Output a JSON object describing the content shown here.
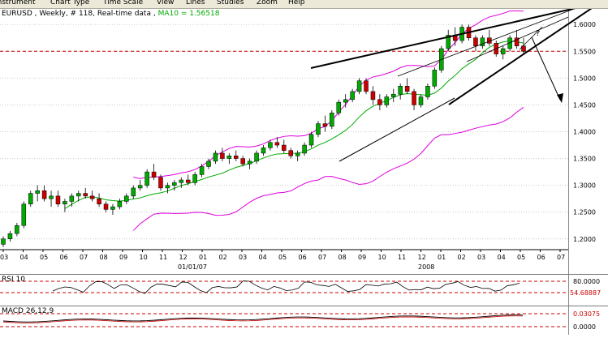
{
  "menu": [
    "Instrument",
    "Chart Type",
    "Time Scale",
    "View",
    "Lines",
    "Studies",
    "Zoom",
    "Help"
  ],
  "chart": {
    "title_prefix": "EURUSD , Weekly, # 118, Real-time data",
    "ma_label": "MA10 = 1.56518",
    "question_mark": "?"
  },
  "price_axis": [
    "1.6000",
    "1.5500",
    "1.5000",
    "1.4500",
    "1.4000",
    "1.3500",
    "1.3000",
    "1.2500",
    "1.2000"
  ],
  "time_axis": [
    "03",
    "04",
    "05",
    "06",
    "07",
    "08",
    "09",
    "10",
    "11",
    "12",
    "01",
    "02",
    "03",
    "04",
    "05",
    "06",
    "07",
    "08",
    "09",
    "10",
    "11",
    "12",
    "01",
    "02",
    "03",
    "04",
    "05",
    "06",
    "07"
  ],
  "date_labels": [
    "01/01/07",
    "2008"
  ],
  "rsi": {
    "title": "RSI 10",
    "upper": "80.0000",
    "value": "54.68887"
  },
  "macd": {
    "title": "MACD 26,12,9",
    "value": "0.03075",
    "zero": "0.0000"
  },
  "colors": {
    "bull": "#00aa00",
    "bear": "#cc0000",
    "band": "#dd00dd",
    "ma": "#00aa00",
    "grid": "#cccccc",
    "ref": "#cc0000"
  },
  "chart_data": {
    "type": "candlestick",
    "ylim": [
      1.18,
      1.62
    ],
    "reference_line": 1.55,
    "weekly_ohlc_approx": [
      [
        1.19,
        1.205,
        1.185,
        1.2
      ],
      [
        1.2,
        1.215,
        1.195,
        1.21
      ],
      [
        1.21,
        1.23,
        1.205,
        1.225
      ],
      [
        1.225,
        1.27,
        1.22,
        1.265
      ],
      [
        1.265,
        1.29,
        1.26,
        1.285
      ],
      [
        1.285,
        1.3,
        1.27,
        1.29
      ],
      [
        1.29,
        1.3,
        1.27,
        1.275
      ],
      [
        1.275,
        1.29,
        1.26,
        1.28
      ],
      [
        1.28,
        1.29,
        1.26,
        1.265
      ],
      [
        1.265,
        1.275,
        1.25,
        1.27
      ],
      [
        1.27,
        1.285,
        1.26,
        1.28
      ],
      [
        1.28,
        1.29,
        1.27,
        1.285
      ],
      [
        1.285,
        1.295,
        1.275,
        1.28
      ],
      [
        1.28,
        1.29,
        1.27,
        1.275
      ],
      [
        1.275,
        1.285,
        1.26,
        1.265
      ],
      [
        1.265,
        1.27,
        1.25,
        1.255
      ],
      [
        1.255,
        1.265,
        1.245,
        1.26
      ],
      [
        1.26,
        1.275,
        1.255,
        1.27
      ],
      [
        1.27,
        1.285,
        1.265,
        1.28
      ],
      [
        1.28,
        1.3,
        1.275,
        1.295
      ],
      [
        1.295,
        1.31,
        1.29,
        1.3
      ],
      [
        1.3,
        1.33,
        1.295,
        1.325
      ],
      [
        1.325,
        1.34,
        1.31,
        1.315
      ],
      [
        1.315,
        1.32,
        1.29,
        1.295
      ],
      [
        1.295,
        1.305,
        1.285,
        1.3
      ],
      [
        1.3,
        1.31,
        1.29,
        1.305
      ],
      [
        1.305,
        1.315,
        1.295,
        1.31
      ],
      [
        1.31,
        1.32,
        1.3,
        1.305
      ],
      [
        1.305,
        1.325,
        1.3,
        1.32
      ],
      [
        1.32,
        1.34,
        1.315,
        1.335
      ],
      [
        1.335,
        1.35,
        1.33,
        1.345
      ],
      [
        1.345,
        1.365,
        1.34,
        1.36
      ],
      [
        1.36,
        1.37,
        1.345,
        1.35
      ],
      [
        1.35,
        1.36,
        1.34,
        1.355
      ],
      [
        1.355,
        1.365,
        1.345,
        1.35
      ],
      [
        1.35,
        1.355,
        1.335,
        1.34
      ],
      [
        1.34,
        1.35,
        1.33,
        1.345
      ],
      [
        1.345,
        1.365,
        1.34,
        1.36
      ],
      [
        1.36,
        1.375,
        1.355,
        1.37
      ],
      [
        1.37,
        1.385,
        1.365,
        1.38
      ],
      [
        1.38,
        1.39,
        1.37,
        1.375
      ],
      [
        1.375,
        1.385,
        1.36,
        1.365
      ],
      [
        1.365,
        1.37,
        1.35,
        1.355
      ],
      [
        1.355,
        1.365,
        1.345,
        1.36
      ],
      [
        1.36,
        1.38,
        1.355,
        1.375
      ],
      [
        1.375,
        1.4,
        1.37,
        1.395
      ],
      [
        1.395,
        1.42,
        1.39,
        1.415
      ],
      [
        1.415,
        1.43,
        1.4,
        1.41
      ],
      [
        1.41,
        1.44,
        1.405,
        1.435
      ],
      [
        1.435,
        1.46,
        1.43,
        1.455
      ],
      [
        1.455,
        1.47,
        1.445,
        1.46
      ],
      [
        1.46,
        1.48,
        1.455,
        1.475
      ],
      [
        1.475,
        1.5,
        1.47,
        1.495
      ],
      [
        1.495,
        1.5,
        1.47,
        1.475
      ],
      [
        1.475,
        1.485,
        1.45,
        1.46
      ],
      [
        1.46,
        1.47,
        1.44,
        1.45
      ],
      [
        1.45,
        1.47,
        1.445,
        1.465
      ],
      [
        1.465,
        1.48,
        1.455,
        1.47
      ],
      [
        1.47,
        1.49,
        1.46,
        1.485
      ],
      [
        1.485,
        1.5,
        1.47,
        1.475
      ],
      [
        1.475,
        1.48,
        1.44,
        1.45
      ],
      [
        1.45,
        1.47,
        1.445,
        1.465
      ],
      [
        1.465,
        1.49,
        1.46,
        1.485
      ],
      [
        1.485,
        1.52,
        1.48,
        1.515
      ],
      [
        1.515,
        1.56,
        1.51,
        1.555
      ],
      [
        1.555,
        1.59,
        1.55,
        1.58
      ],
      [
        1.58,
        1.595,
        1.56,
        1.57
      ],
      [
        1.57,
        1.6,
        1.565,
        1.595
      ],
      [
        1.595,
        1.6,
        1.57,
        1.575
      ],
      [
        1.575,
        1.58,
        1.55,
        1.56
      ],
      [
        1.56,
        1.58,
        1.555,
        1.575
      ],
      [
        1.575,
        1.59,
        1.56,
        1.565
      ],
      [
        1.565,
        1.57,
        1.54,
        1.545
      ],
      [
        1.545,
        1.56,
        1.535,
        1.555
      ],
      [
        1.555,
        1.58,
        1.55,
        1.575
      ],
      [
        1.575,
        1.59,
        1.555,
        1.56
      ],
      [
        1.56,
        1.575,
        1.545,
        1.55
      ]
    ]
  }
}
